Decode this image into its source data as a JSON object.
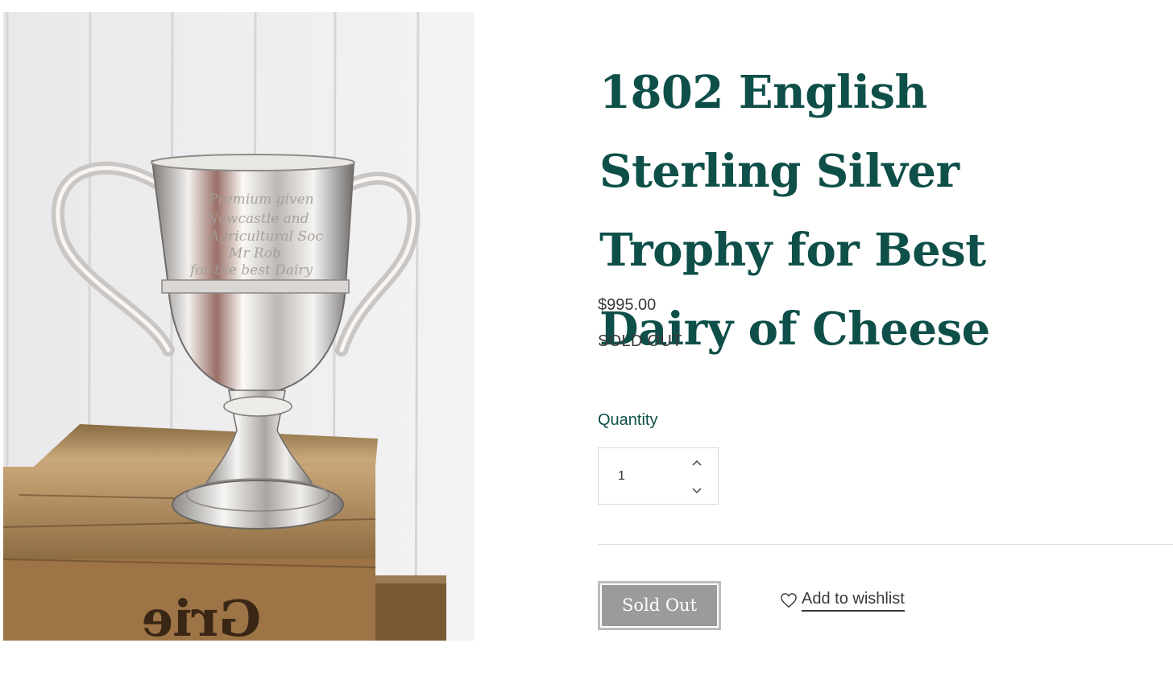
{
  "product": {
    "title": "1802 English Sterling Silver Trophy for Best Dairy of Cheese",
    "price": "$995.00",
    "stock_status": "SOLD OUT",
    "image_alt": "Silver two-handled trophy cup on a wooden crate"
  },
  "quantity": {
    "label": "Quantity",
    "value": "1",
    "increase_icon": "chevron-up-icon",
    "decrease_icon": "chevron-down-icon"
  },
  "actions": {
    "sold_out_label": "Sold Out",
    "wishlist_label": "Add to wishlist",
    "wishlist_icon": "heart-icon"
  },
  "colors": {
    "title": "#0f4f49",
    "text": "#3a3a3a",
    "button_bg": "#9b9b9b"
  }
}
